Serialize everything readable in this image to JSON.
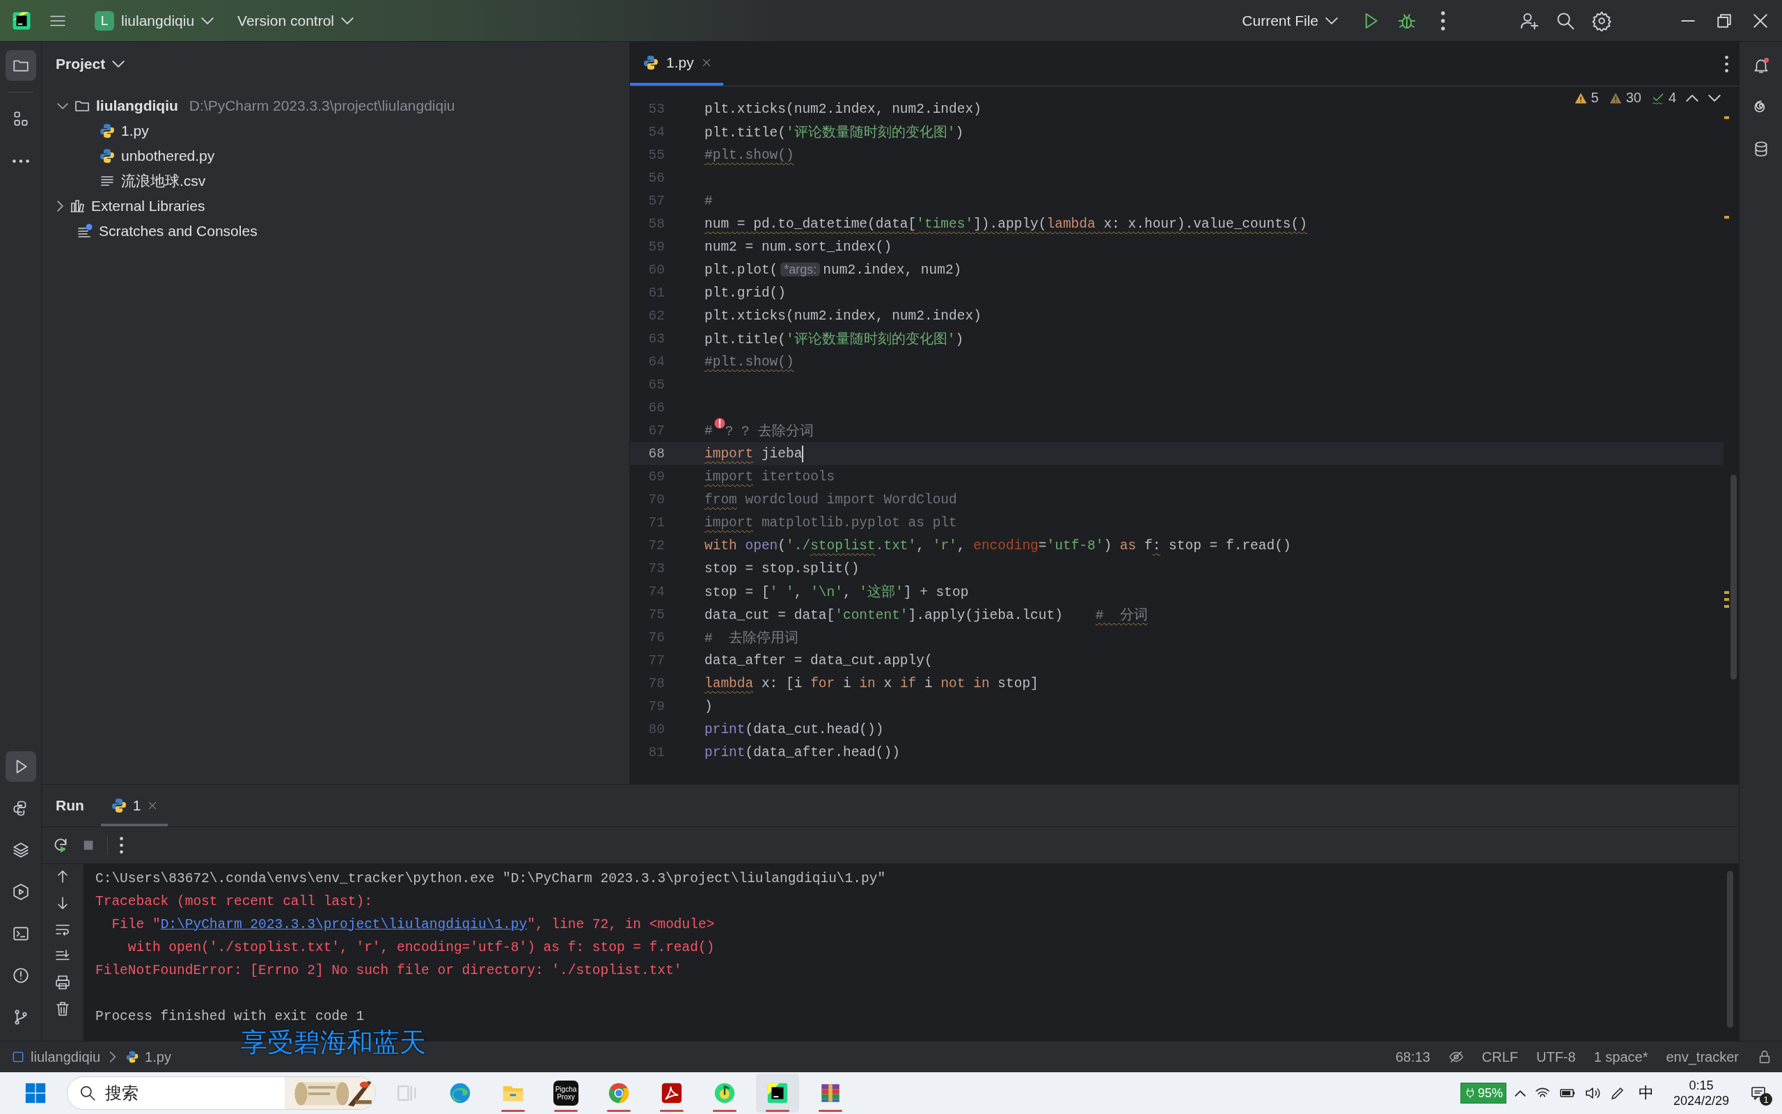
{
  "title_bar": {
    "project_badge": "L",
    "project": "liulangdiqiu",
    "vcs": "Version control",
    "run_config": "Current File"
  },
  "left_toolbar": {
    "top": [
      {
        "kind": "folder",
        "selected": true
      },
      {
        "kind": "structure",
        "selected": false
      },
      {
        "kind": "more",
        "selected": false
      }
    ],
    "bottom": [
      {
        "kind": "run",
        "selected": true
      },
      {
        "kind": "pyconsole",
        "selected": false
      },
      {
        "kind": "layers",
        "selected": false
      },
      {
        "kind": "services",
        "selected": false
      },
      {
        "kind": "terminal",
        "selected": false
      },
      {
        "kind": "problems",
        "selected": false
      },
      {
        "kind": "git",
        "selected": false
      }
    ]
  },
  "right_toolbar": [
    {
      "kind": "bell"
    },
    {
      "kind": "spiral"
    },
    {
      "kind": "database"
    }
  ],
  "project_panel": {
    "title": "Project",
    "tree": [
      {
        "label": "liulangdiqiu",
        "kind": "folder",
        "path": "D:\\PyCharm 2023.3.3\\project\\liulangdiqiu",
        "expanded": true,
        "children": [
          {
            "label": "1.py",
            "kind": "python"
          },
          {
            "label": "unbothered.py",
            "kind": "python"
          },
          {
            "label": "流浪地球.csv",
            "kind": "text"
          }
        ]
      },
      {
        "label": "External Libraries",
        "kind": "library",
        "expanded": false
      },
      {
        "label": "Scratches and Consoles",
        "kind": "scratches"
      }
    ]
  },
  "editor": {
    "tabs": [
      {
        "label": "1.py",
        "selected": true
      }
    ],
    "inspections": [
      {
        "kind": "warning",
        "count": "5"
      },
      {
        "kind": "weak_warning",
        "count": "30"
      },
      {
        "kind": "typo",
        "count": "4"
      }
    ],
    "lines": [
      {
        "number": "53",
        "current": false,
        "tokens": [
          {
            "text": "plt.xticks(num2.index, num2.index)",
            "kind": "plain",
            "underlined": false
          }
        ]
      },
      {
        "number": "54",
        "current": false,
        "tokens": [
          {
            "text": "plt.title(",
            "kind": "plain",
            "underlined": false
          },
          {
            "text": "'评论数量随时刻的变化图'",
            "kind": "string",
            "underlined": false
          },
          {
            "text": ")",
            "kind": "plain",
            "underlined": false
          }
        ]
      },
      {
        "number": "55",
        "current": false,
        "tokens": [
          {
            "text": "#plt.show()",
            "kind": "comment",
            "underlined": true
          }
        ]
      },
      {
        "number": "56",
        "current": false
      },
      {
        "number": "57",
        "current": false,
        "tokens": [
          {
            "text": "#",
            "kind": "comment",
            "underlined": false
          }
        ]
      },
      {
        "number": "58",
        "current": false,
        "tokens": [
          {
            "text": "num = pd.to_datetime(data[",
            "kind": "plain",
            "underlined": true
          },
          {
            "text": "'times'",
            "kind": "string",
            "underlined": true
          },
          {
            "text": "]).apply(",
            "kind": "plain",
            "underlined": true
          },
          {
            "text": "lambda",
            "kind": "keyword",
            "underlined": true
          },
          {
            "text": " x: x.hour).value_counts()",
            "kind": "plain",
            "underlined": true
          }
        ]
      },
      {
        "number": "59",
        "current": false,
        "tokens": [
          {
            "text": "num2 = num.sort_index()",
            "kind": "plain",
            "underlined": false
          }
        ]
      },
      {
        "number": "60",
        "current": false,
        "tokens": [
          {
            "text": "plt.plot(",
            "kind": "plain",
            "underlined": false
          },
          {
            "text": "*args:",
            "kind": "hint",
            "underlined": false
          },
          {
            "text": "num2.index, num2)",
            "kind": "plain",
            "underlined": false
          }
        ]
      },
      {
        "number": "61",
        "current": false,
        "tokens": [
          {
            "text": "plt.grid()",
            "kind": "plain",
            "underlined": false
          }
        ]
      },
      {
        "number": "62",
        "current": false,
        "tokens": [
          {
            "text": "plt.xticks(num2.index, num2.index)",
            "kind": "plain",
            "underlined": false
          }
        ]
      },
      {
        "number": "63",
        "current": false,
        "tokens": [
          {
            "text": "plt.title(",
            "kind": "plain",
            "underlined": false
          },
          {
            "text": "'评论数量随时刻的变化图'",
            "kind": "string",
            "underlined": false
          },
          {
            "text": ")",
            "kind": "plain",
            "underlined": false
          }
        ]
      },
      {
        "number": "64",
        "current": false,
        "tokens": [
          {
            "text": "#plt.show()",
            "kind": "comment",
            "underlined": true
          }
        ]
      },
      {
        "number": "65",
        "current": false
      },
      {
        "number": "66",
        "current": false
      },
      {
        "number": "67",
        "current": false,
        "tokens": [
          {
            "text": "#",
            "kind": "comment",
            "underlined": false
          },
          {
            "kind": "bulb"
          },
          {
            "text": "? ? 去除分词",
            "kind": "comment",
            "underlined": false
          }
        ]
      },
      {
        "number": "68",
        "current": true,
        "tokens": [
          {
            "text": "import",
            "kind": "keyword",
            "underlined": true
          },
          {
            "text": " jieba",
            "kind": "plain",
            "underlined": false
          }
        ]
      },
      {
        "number": "69",
        "current": false,
        "tokens": [
          {
            "text": "import",
            "kind": "unused",
            "underlined": true
          },
          {
            "text": " itertools",
            "kind": "unused",
            "underlined": false
          }
        ]
      },
      {
        "number": "70",
        "current": false,
        "tokens": [
          {
            "text": "from",
            "kind": "unused",
            "underlined": true
          },
          {
            "text": " wordcloud import WordCloud",
            "kind": "unused",
            "underlined": false
          }
        ]
      },
      {
        "number": "71",
        "current": false,
        "tokens": [
          {
            "text": "import",
            "kind": "unused",
            "underlined": true
          },
          {
            "text": " matplotlib.pyplot as plt",
            "kind": "unused",
            "underlined": false
          }
        ]
      },
      {
        "number": "72",
        "current": false,
        "tokens": [
          {
            "text": "with ",
            "kind": "keyword",
            "underlined": false
          },
          {
            "text": "open",
            "kind": "builtin",
            "underlined": false
          },
          {
            "text": "(",
            "kind": "plain",
            "underlined": false
          },
          {
            "text": "'./",
            "kind": "string",
            "underlined": false
          },
          {
            "text": "stoplist",
            "kind": "string",
            "underlined": true
          },
          {
            "text": ".txt'",
            "kind": "string",
            "underlined": false
          },
          {
            "text": ", ",
            "kind": "plain",
            "underlined": false
          },
          {
            "text": "'r'",
            "kind": "string",
            "underlined": false
          },
          {
            "text": ", ",
            "kind": "plain",
            "underlined": false
          },
          {
            "text": "encoding",
            "kind": "param",
            "underlined": false
          },
          {
            "text": "=",
            "kind": "plain",
            "underlined": false
          },
          {
            "text": "'utf-8'",
            "kind": "string",
            "underlined": false
          },
          {
            "text": ") ",
            "kind": "plain",
            "underlined": false
          },
          {
            "text": "as",
            "kind": "keyword",
            "underlined": false
          },
          {
            "text": " f",
            "kind": "plain",
            "underlined": false
          },
          {
            "text": ":",
            "kind": "plain",
            "underlined": true
          },
          {
            "text": " stop = f.read()",
            "kind": "plain",
            "underlined": false
          }
        ]
      },
      {
        "number": "73",
        "current": false,
        "tokens": [
          {
            "text": "stop = stop.split()",
            "kind": "plain",
            "underlined": false
          }
        ]
      },
      {
        "number": "74",
        "current": false,
        "tokens": [
          {
            "text": "stop = [",
            "kind": "plain",
            "underlined": false
          },
          {
            "text": "' '",
            "kind": "string",
            "underlined": false
          },
          {
            "text": ", ",
            "kind": "plain",
            "underlined": false
          },
          {
            "text": "'\\n'",
            "kind": "string",
            "underlined": false
          },
          {
            "text": ", ",
            "kind": "plain",
            "underlined": false
          },
          {
            "text": "'这部'",
            "kind": "string",
            "underlined": false
          },
          {
            "text": "] + stop",
            "kind": "plain",
            "underlined": false
          }
        ]
      },
      {
        "number": "75",
        "current": false,
        "tokens": [
          {
            "text": "data_cut = data[",
            "kind": "plain",
            "underlined": false
          },
          {
            "text": "'content'",
            "kind": "string",
            "underlined": false
          },
          {
            "text": "].apply(jieba.lcut)    ",
            "kind": "plain",
            "underlined": false
          },
          {
            "text": "#  分词",
            "kind": "comment",
            "underlined": true
          }
        ]
      },
      {
        "number": "76",
        "current": false,
        "tokens": [
          {
            "text": "#  去除停用词",
            "kind": "comment",
            "underlined": false
          }
        ]
      },
      {
        "number": "77",
        "current": false,
        "tokens": [
          {
            "text": "data_after = data_cut.apply(",
            "kind": "plain",
            "underlined": false
          }
        ]
      },
      {
        "number": "78",
        "current": false,
        "tokens": [
          {
            "text": "lambda",
            "kind": "keyword",
            "underlined": true
          },
          {
            "text": " x: [i ",
            "kind": "plain",
            "underlined": false
          },
          {
            "text": "for",
            "kind": "keyword",
            "underlined": false
          },
          {
            "text": " i ",
            "kind": "plain",
            "underlined": false
          },
          {
            "text": "in",
            "kind": "keyword",
            "underlined": false
          },
          {
            "text": " x ",
            "kind": "plain",
            "underlined": false
          },
          {
            "text": "if",
            "kind": "keyword",
            "underlined": false
          },
          {
            "text": " i ",
            "kind": "plain",
            "underlined": false
          },
          {
            "text": "not in",
            "kind": "keyword",
            "underlined": false
          },
          {
            "text": " stop]",
            "kind": "plain",
            "underlined": false
          }
        ]
      },
      {
        "number": "79",
        "current": false,
        "tokens": [
          {
            "text": ")",
            "kind": "plain",
            "underlined": false
          }
        ]
      },
      {
        "number": "80",
        "current": false,
        "tokens": [
          {
            "text": "print",
            "kind": "builtin",
            "underlined": false
          },
          {
            "text": "(data_cut.head())",
            "kind": "plain",
            "underlined": false
          }
        ]
      },
      {
        "number": "81",
        "current": false,
        "tokens": [
          {
            "text": "print",
            "kind": "builtin",
            "underlined": false
          },
          {
            "text": "(data_after.head())",
            "kind": "plain",
            "underlined": false
          }
        ]
      }
    ]
  },
  "run_panel": {
    "title": "Run",
    "tabs": [
      {
        "label": "1",
        "selected": true
      }
    ],
    "output": [
      {
        "gap_before": false,
        "parts": [
          {
            "text": "C:\\Users\\83672\\.conda\\envs\\env_tracker\\python.exe \"D:\\PyCharm 2023.3.3\\project\\liulangdiqiu\\1.py\"",
            "kind": "normal"
          }
        ]
      },
      {
        "gap_before": false,
        "parts": [
          {
            "text": "Traceback (most recent call last):",
            "kind": "error"
          }
        ]
      },
      {
        "gap_before": false,
        "parts": [
          {
            "text": "  File \"",
            "kind": "error"
          },
          {
            "text": "D:\\PyCharm 2023.3.3\\project\\liulangdiqiu\\1.py",
            "kind": "link"
          },
          {
            "text": "\", line 72, in <module>",
            "kind": "error"
          }
        ]
      },
      {
        "gap_before": false,
        "parts": [
          {
            "text": "    with open('./stoplist.txt', 'r', encoding='utf-8') as f: stop = f.read()",
            "kind": "error"
          }
        ]
      },
      {
        "gap_before": false,
        "parts": [
          {
            "text": "FileNotFoundError: [Errno 2] No such file or directory: './stoplist.txt'",
            "kind": "error"
          }
        ]
      },
      {
        "gap_before": true,
        "parts": [
          {
            "text": "Process finished with exit code 1",
            "kind": "normal"
          }
        ]
      }
    ]
  },
  "status_bar": {
    "breadcrumbs": [
      {
        "label": "liulangdiqiu",
        "kind": "module"
      },
      {
        "label": "1.py",
        "kind": "python"
      }
    ],
    "position": "68:13",
    "line_separator": "CRLF",
    "encoding": "UTF-8",
    "indent": "1 space*",
    "interpreter": "env_tracker"
  },
  "overlay_text": "享受碧海和蓝天",
  "taskbar": {
    "search_placeholder": "搜索",
    "apps": [
      {
        "kind": "taskview",
        "running": false,
        "selected": false
      },
      {
        "kind": "edge",
        "running": false,
        "selected": false
      },
      {
        "kind": "explorer",
        "running": true,
        "selected": false
      },
      {
        "kind": "pigcha",
        "label_lines": [
          "Pigcha",
          "Proxy"
        ],
        "running": true,
        "selected": false
      },
      {
        "kind": "chrome",
        "running": true,
        "selected": false
      },
      {
        "kind": "acrobat",
        "running": true,
        "selected": false
      },
      {
        "kind": "music",
        "running": true,
        "selected": false
      },
      {
        "kind": "pycharm",
        "running": true,
        "selected": true
      },
      {
        "kind": "winrar",
        "running": true,
        "selected": false
      }
    ],
    "battery": "95%",
    "ime": "中",
    "time": "0:15",
    "date": "2024/2/29",
    "notifications": "1"
  }
}
